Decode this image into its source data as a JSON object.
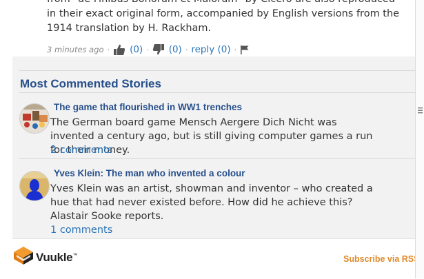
{
  "comment": {
    "lines": [
      "from \"de Finibus Bonorum et Malorum\" by Cicero are also reproduced",
      "in their exact original form, accompanied by English versions from the",
      "1914 translation by H. Rackham."
    ],
    "time": "3 minutes ago",
    "likes": "(0)",
    "dislikes": "(0)",
    "reply": "reply (0)",
    "separator": "·"
  },
  "section": {
    "title": "Most Commented Stories"
  },
  "stories": [
    {
      "title": "The game that flourished in WW1 trenches",
      "summary": "The German board game Mensch Aergere Dich Nicht was invented a century ago, but is still giving computer games a run for their money.",
      "comments": "2 comments"
    },
    {
      "title": "Yves Klein: The man who invented a colour",
      "summary": "Yves Klein was an artist, showman and inventor – who created a hue that had never existed before. How did he achieve this? Alastair Sooke reports.",
      "comments": "1 comments"
    }
  ],
  "footer": {
    "brand": "Vuukle",
    "trademark": "™",
    "rss": "Subscribe via RSS"
  },
  "colors": {
    "link": "#2a74b8",
    "title": "#274f8c",
    "rss": "#e08a2a",
    "widget_bg": "#f2f2f2"
  },
  "icons": [
    "thumbs-up-icon",
    "thumbs-down-icon",
    "flag-icon",
    "vuukle-logo",
    "scroll-grip-icon"
  ]
}
